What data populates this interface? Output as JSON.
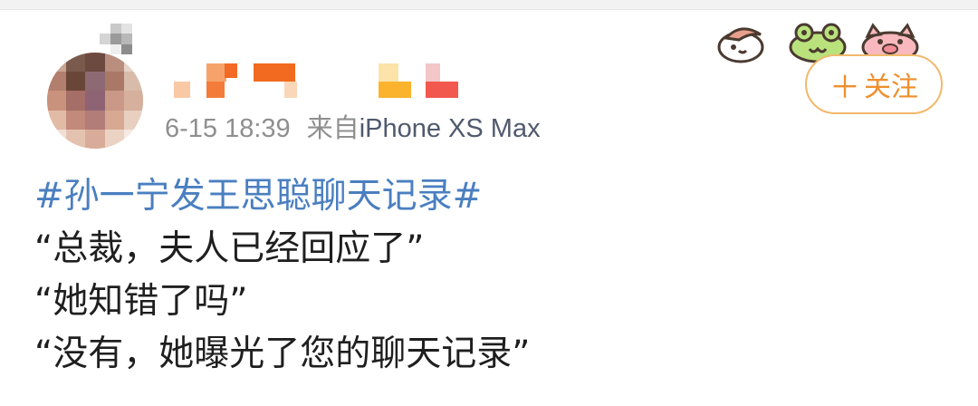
{
  "post": {
    "timestamp": "6-15 18:39",
    "source_prefix": "来自",
    "source_device": "iPhone XS Max",
    "hashtag": "#孙一宁发王思聪聊天记录#",
    "lines": [
      "“总裁，夫人已经回应了”",
      "“她知错了吗”",
      "“没有，她曝光了您的聊天记录”"
    ]
  },
  "follow_button": {
    "icon": "plus-icon",
    "label": "关注",
    "color": "#ee8f2c",
    "border_color": "#f1b96d"
  },
  "colors": {
    "hashtag": "#4a7fc0",
    "meta": "#8f8f8f",
    "text": "#1f1f1f"
  }
}
